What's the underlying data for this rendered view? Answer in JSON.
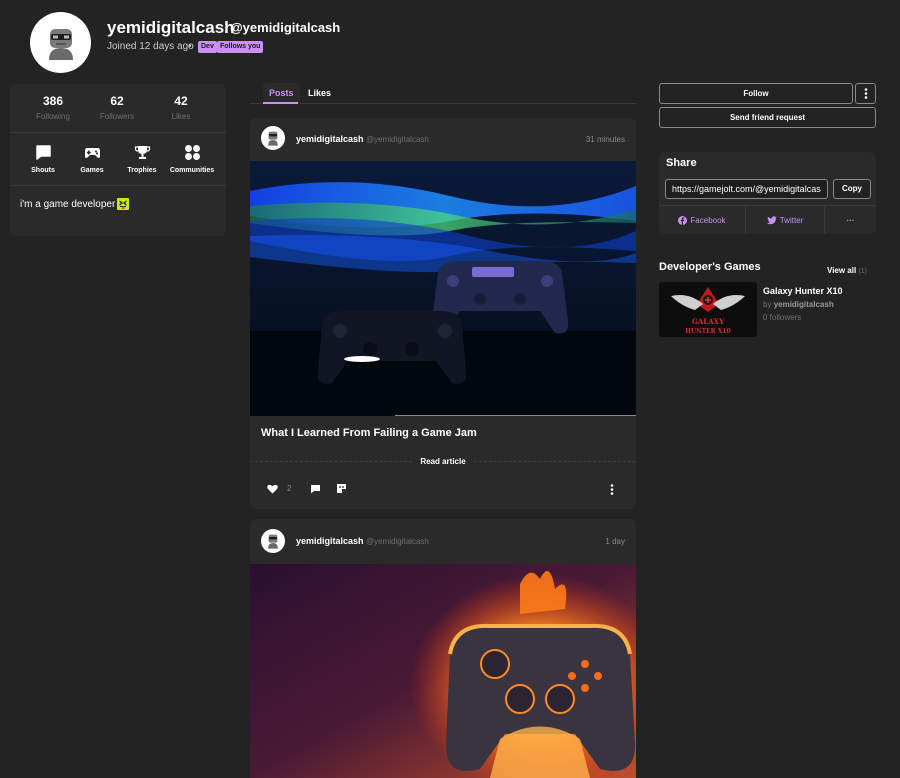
{
  "profile": {
    "username": "yemidigitalcash",
    "handle": "@yemidigitalcash",
    "joined": "Joined 12 days ago",
    "badges": [
      "Dev",
      "Follows you"
    ],
    "bio": "i'm a game developer",
    "bio_emoji": "tongue-out-emoji"
  },
  "stats": [
    {
      "value": "386",
      "label": "Following"
    },
    {
      "value": "62",
      "label": "Followers"
    },
    {
      "value": "42",
      "label": "Likes"
    }
  ],
  "nav": [
    {
      "label": "Shouts",
      "icon": "speech-bubble-icon"
    },
    {
      "label": "Games",
      "icon": "gamepad-icon"
    },
    {
      "label": "Trophies",
      "icon": "trophy-icon"
    },
    {
      "label": "Communities",
      "icon": "communities-icon"
    }
  ],
  "tabs": {
    "posts": "Posts",
    "likes": "Likes"
  },
  "posts": [
    {
      "user": "yemidigitalcash",
      "handle": "@yemidigitalcash",
      "time": "31 minutes",
      "title": "What I Learned From Failing a Game Jam",
      "read_label": "Read article",
      "likes": "2"
    },
    {
      "user": "yemidigitalcash",
      "handle": "@yemidigitalcash",
      "time": "1 day"
    }
  ],
  "actions": {
    "follow": "Follow",
    "friend_request": "Send friend request"
  },
  "share": {
    "title": "Share",
    "url": "https://gamejolt.com/@yemidigitalcash",
    "copy": "Copy",
    "facebook": "Facebook",
    "twitter": "Twitter",
    "more": "···"
  },
  "dev_games": {
    "title": "Developer's Games",
    "view_all": "View all",
    "view_all_count": "(1)",
    "game": {
      "name": "Galaxy Hunter X10",
      "by_prefix": "by",
      "by_user": "yemidigitalcash",
      "followers": "0 followers",
      "logo_text_1": "GALAXY",
      "logo_text_2": "HUNTER X10"
    }
  },
  "colors": {
    "background": "#232323",
    "card": "#2a2a2a",
    "accent": "#cc8ff5",
    "muted": "#6f6f6f"
  }
}
